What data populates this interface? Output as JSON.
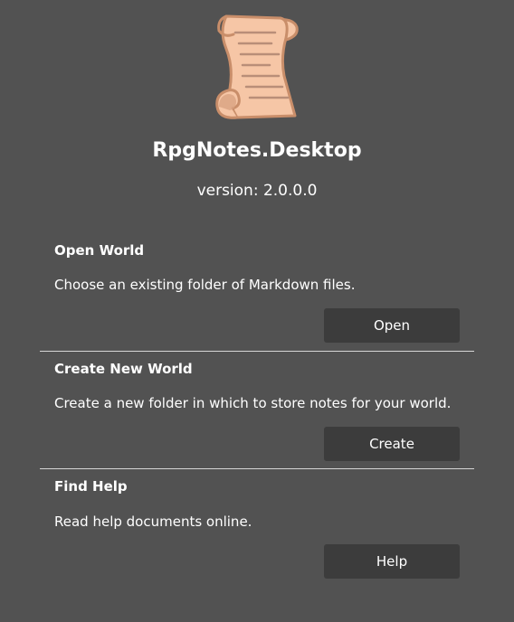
{
  "app": {
    "title": "RpgNotes.Desktop",
    "version": "version: 2.0.0.0",
    "logo_icon": "scroll-icon"
  },
  "colors": {
    "background": "#525252",
    "button": "#3c3c3c",
    "text": "#ffffff",
    "divider": "#d6d6d6",
    "scroll_fill": "#f6c6a6",
    "scroll_outline": "#c98e6a"
  },
  "sections": [
    {
      "title": "Open World",
      "description": "Choose an existing folder of Markdown files.",
      "button_label": "Open"
    },
    {
      "title": "Create New World",
      "description": "Create a new folder in which to store notes for your world.",
      "button_label": "Create"
    },
    {
      "title": "Find Help",
      "description": "Read help documents online.",
      "button_label": "Help"
    }
  ]
}
